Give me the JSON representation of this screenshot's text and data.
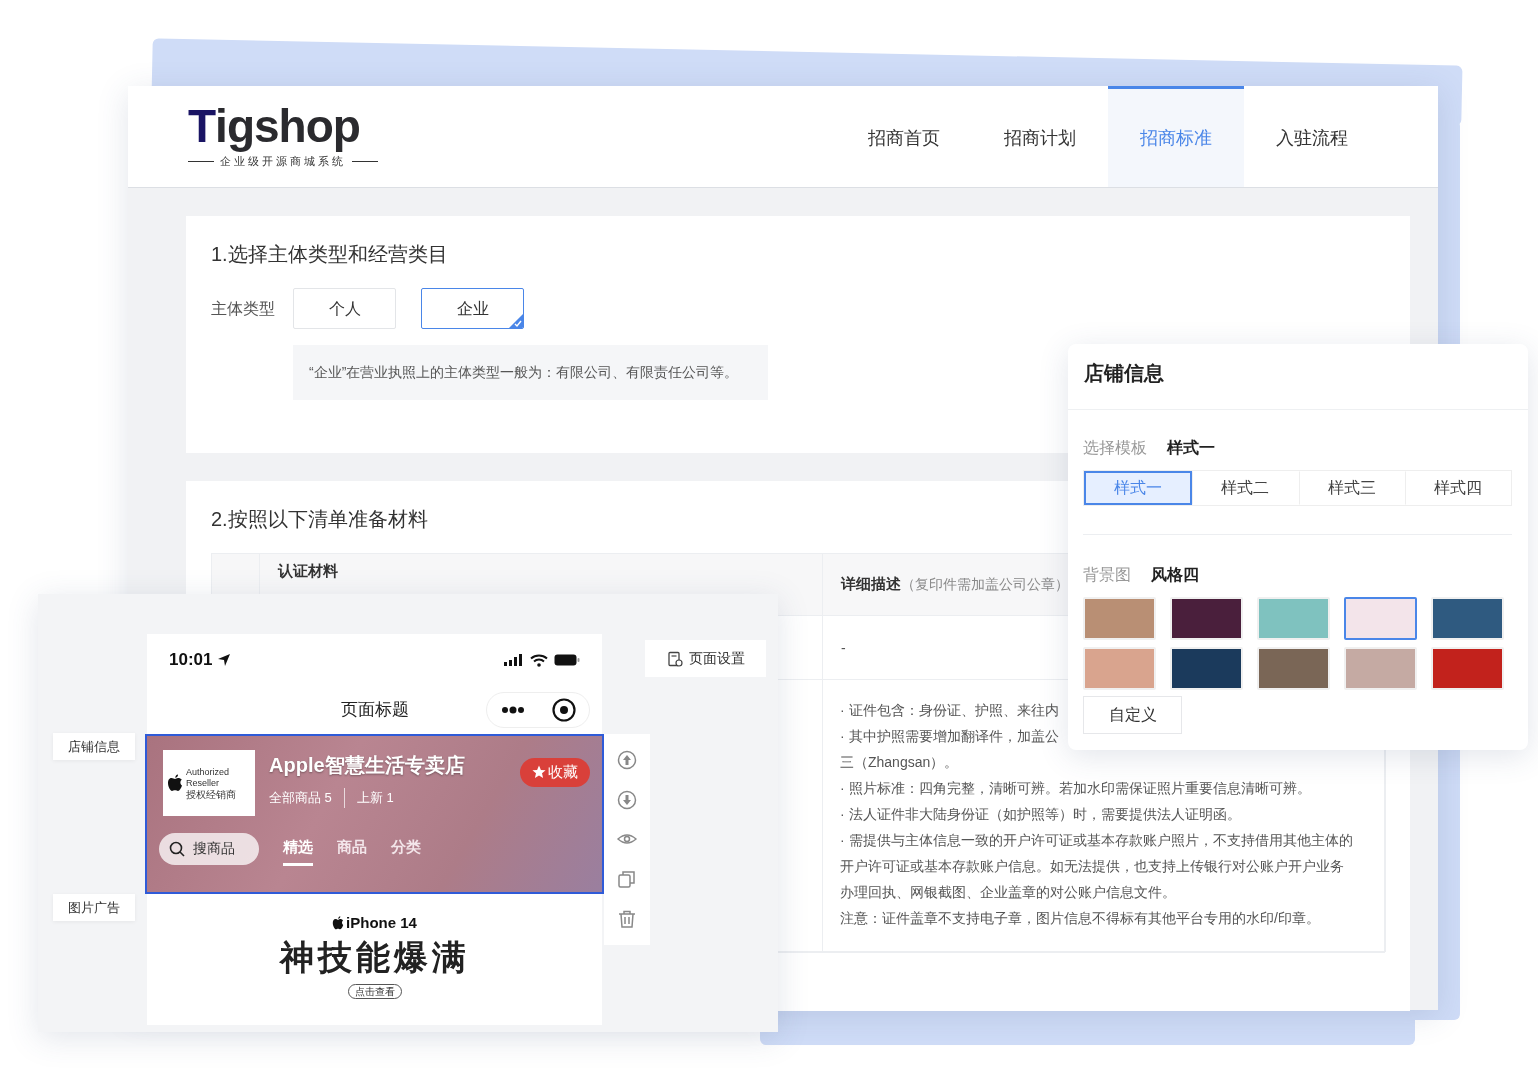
{
  "header": {
    "logo": {
      "mark": "T",
      "word": "igshop",
      "tagline": "企业级开源商城系统"
    },
    "nav": [
      {
        "label": "招商首页",
        "selected": false
      },
      {
        "label": "招商计划",
        "selected": false
      },
      {
        "label": "招商标准",
        "selected": true
      },
      {
        "label": "入驻流程",
        "selected": false
      }
    ]
  },
  "section_1": {
    "title": "1.选择主体类型和经营类目",
    "field_label": "主体类型",
    "options": [
      {
        "label": "个人",
        "selected": false
      },
      {
        "label": "企业",
        "selected": true
      }
    ],
    "note": "“企业”在营业执照上的主体类型一般为：有限公司、有限责任公司等。"
  },
  "section_2": {
    "title": "2.按照以下清单准备材料",
    "columns": [
      {
        "label": "认证材料"
      },
      {
        "label": "详细描述",
        "note": "（复印件需加盖公司公章）"
      }
    ],
    "rows": [
      {
        "details": [
          "-"
        ]
      },
      {
        "details": [
          "· 证件包含：身份证、护照、来往内",
          "· 其中护照需要增加翻译件，加盖公",
          "三（Zhangsan）。",
          "· 照片标准：四角完整，清晰可辨。若加水印需保证照片重要信息清晰可辨。",
          "· 法人证件非大陆身份证（如护照等）时，需要提供法人证明函。",
          "· 需提供与主体信息一致的开户许可证或基本存款账户照片，不支持借用其他主体的",
          "开户许可证或基本存款账户信息。如无法提供，也支持上传银行对公账户开户业务",
          "办理回执、网银截图、企业盖章的对公账户信息文件。",
          "注意：证件盖章不支持电子章，图片信息不得标有其他平台专用的水印/印章。"
        ]
      }
    ]
  },
  "editor": {
    "page_settings": "页面设置",
    "side_labels": [
      "店铺信息",
      "图片广告"
    ],
    "phone": {
      "time": "10:01",
      "title": "页面标题",
      "store": {
        "selected": true,
        "logo_lines": [
          "Authorized",
          "Reseller",
          "授权经销商"
        ],
        "name": "Apple智慧生活专卖店",
        "follow": "收藏",
        "stats": [
          "全部商品 5",
          "上新 1"
        ],
        "search_placeholder": "搜商品",
        "tabs": [
          {
            "label": "精选",
            "selected": true
          },
          {
            "label": "商品",
            "selected": false
          },
          {
            "label": "分类",
            "selected": false
          }
        ]
      },
      "ad": {
        "brand": "iPhone 14",
        "headline": "神技能爆满",
        "cta": "点击查看"
      }
    }
  },
  "store_panel": {
    "title": "店铺信息",
    "template_label": "选择模板",
    "template_value": "样式一",
    "templates": [
      {
        "label": "样式一",
        "selected": true
      },
      {
        "label": "样式二",
        "selected": false
      },
      {
        "label": "样式三",
        "selected": false
      },
      {
        "label": "样式四",
        "selected": false
      }
    ],
    "background_label": "背景图",
    "background_value": "风格四",
    "backgrounds": [
      {
        "color": "#b98f74",
        "selected": false
      },
      {
        "color": "#4a1f3c",
        "selected": false
      },
      {
        "color": "#7fc2bf",
        "selected": false
      },
      {
        "color": "#f3e4ea",
        "selected": true
      },
      {
        "color": "#2f5a80",
        "selected": false
      },
      {
        "color": "#d9a48e",
        "selected": false
      },
      {
        "color": "#1b3a5c",
        "selected": false
      },
      {
        "color": "#7a6656",
        "selected": false
      },
      {
        "color": "#c5aaa3",
        "selected": false
      },
      {
        "color": "#c2221c",
        "selected": false
      }
    ],
    "custom_button": "自定义"
  }
}
